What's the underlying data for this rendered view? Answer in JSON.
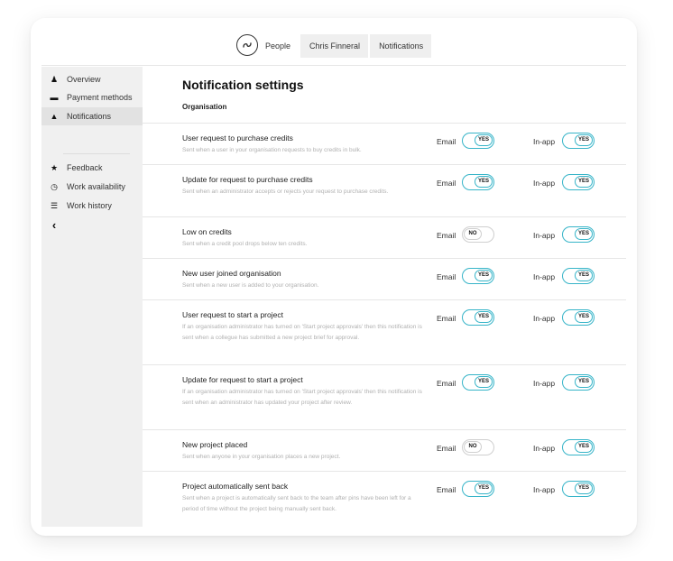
{
  "breadcrumb": [
    "People",
    "Chris Finneral",
    "Notifications"
  ],
  "sidebar": {
    "items": [
      {
        "label": "Overview",
        "icon": "person-icon",
        "glyph": "♟"
      },
      {
        "label": "Payment methods",
        "icon": "card-icon",
        "glyph": "▬"
      },
      {
        "label": "Notifications",
        "icon": "bell-icon",
        "glyph": "▲",
        "active": true
      },
      {
        "label": "Feedback",
        "icon": "star-icon",
        "glyph": "★"
      },
      {
        "label": "Work availability",
        "icon": "clock-icon",
        "glyph": "◷"
      },
      {
        "label": "Work history",
        "icon": "list-icon",
        "glyph": "☰"
      }
    ],
    "collapse_icon": "chevron-left-icon",
    "collapse_glyph": "‹"
  },
  "main": {
    "title": "Notification settings",
    "section": "Organisation",
    "email_label": "Email",
    "inapp_label": "In-app",
    "yes_label": "YES",
    "no_label": "NO",
    "rows": [
      {
        "title": "User request to purchase credits",
        "desc": "Sent when a user in your organisation requests to buy credits in bulk.",
        "email": true,
        "inapp": true
      },
      {
        "title": "Update for request to purchase credits",
        "desc": "Sent when an administrator accepts or rejects your request to purchase credits.",
        "email": true,
        "inapp": true
      },
      {
        "title": "Low on credits",
        "desc": "Sent when a credit pool drops below ten credits.",
        "email": false,
        "inapp": true
      },
      {
        "title": "New user joined organisation",
        "desc": "Sent when a new user is added to your organisation.",
        "email": true,
        "inapp": true
      },
      {
        "title": "User request to start a project",
        "desc": "If an organisation administrator has turned on 'Start project approvals' then this notification is sent when a collegue has submitted a new project brief for approval.",
        "email": true,
        "inapp": true
      },
      {
        "title": "Update for request to start a project",
        "desc": "If an organisation administrator has turned on 'Start project approvals' then this notification is sent when an administrator has updated your project after review.",
        "email": true,
        "inapp": true
      },
      {
        "title": "New project placed",
        "desc": "Sent when anyone in your organisation places a new project.",
        "email": false,
        "inapp": true
      },
      {
        "title": "Project automatically sent back",
        "desc": "Sent when a project is automatically sent back to the team after pins have been left for a period of time without the project being manually sent back.",
        "email": true,
        "inapp": true
      }
    ]
  },
  "colors": {
    "accent": "#36b4c8",
    "off": "#cfcfcf",
    "sidebar": "#f0f0f0"
  }
}
